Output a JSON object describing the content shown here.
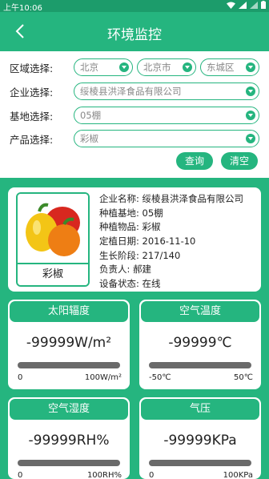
{
  "status_bar": {
    "time": "上午10:06"
  },
  "app_bar": {
    "title": "环境监控"
  },
  "filters": {
    "region_label": "区域选择:",
    "province": "北京",
    "city": "北京市",
    "district": "东城区",
    "company_label": "企业选择:",
    "company": "绥棱县洪泽食品有限公司",
    "base_label": "基地选择:",
    "base": "05棚",
    "product_label": "产品选择:",
    "product": "彩椒",
    "query_button": "查询",
    "clear_button": "清空"
  },
  "product_info": {
    "image_caption": "彩椒",
    "company": "企业名称: 绥棱县洪泽食品有限公司",
    "base": "种植基地: 05棚",
    "item": "种植物品: 彩椒",
    "date": "定植日期: 2016-11-10",
    "stage": "生长阶段: 217/140",
    "owner": "负责人: 郝建",
    "device": "设备状态: 在线"
  },
  "sensors": [
    {
      "title": "太阳辐度",
      "value": "-99999W/m²",
      "min": "0",
      "max": "100W/m²",
      "level": 0
    },
    {
      "title": "空气温度",
      "value": "-99999℃",
      "min": "-50℃",
      "max": "50℃",
      "level": 0
    },
    {
      "title": "空气湿度",
      "value": "-99999RH%",
      "min": "0",
      "max": "100RH%",
      "level": 0
    },
    {
      "title": "气压",
      "value": "-99999KPa",
      "min": "0",
      "max": "100KPa",
      "level": 0
    }
  ],
  "colors": {
    "accent": "#25b57f",
    "status_bar": "#1c9c6b",
    "track": "#6a6a6a"
  },
  "icons": [
    "back-arrow-icon",
    "dropdown-arrow-icon",
    "wifi-icon",
    "signal-icon",
    "battery-icon"
  ]
}
